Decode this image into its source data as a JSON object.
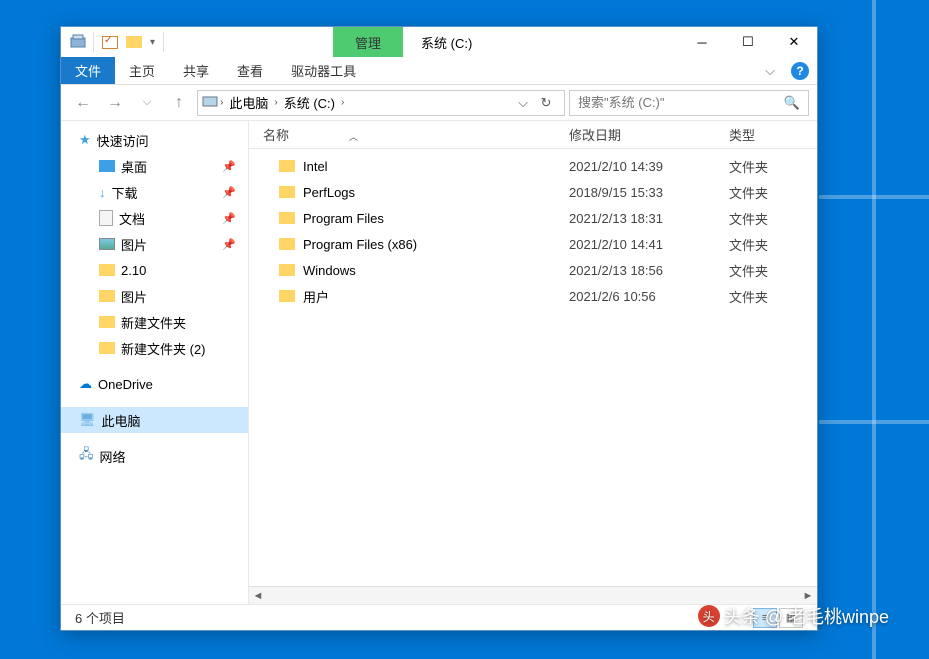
{
  "window": {
    "context_tab": "管理",
    "title": "系统 (C:)",
    "ribbon": {
      "file": "文件",
      "home": "主页",
      "share": "共享",
      "view": "查看",
      "drive_tools": "驱动器工具"
    }
  },
  "address": {
    "root": "此电脑",
    "location": "系统 (C:)"
  },
  "search": {
    "placeholder": "搜索\"系统 (C:)\""
  },
  "nav": {
    "quick_access": "快速访问",
    "desktop": "桌面",
    "downloads": "下载",
    "documents": "文档",
    "pictures": "图片",
    "folder_210": "2.10",
    "pictures2": "图片",
    "new_folder": "新建文件夹",
    "new_folder2": "新建文件夹 (2)",
    "onedrive": "OneDrive",
    "this_pc": "此电脑",
    "network": "网络"
  },
  "columns": {
    "name": "名称",
    "date_modified": "修改日期",
    "type": "类型"
  },
  "files": [
    {
      "name": "Intel",
      "date": "2021/2/10 14:39",
      "type": "文件夹"
    },
    {
      "name": "PerfLogs",
      "date": "2018/9/15 15:33",
      "type": "文件夹"
    },
    {
      "name": "Program Files",
      "date": "2021/2/13 18:31",
      "type": "文件夹"
    },
    {
      "name": "Program Files (x86)",
      "date": "2021/2/10 14:41",
      "type": "文件夹"
    },
    {
      "name": "Windows",
      "date": "2021/2/13 18:56",
      "type": "文件夹"
    },
    {
      "name": "用户",
      "date": "2021/2/6 10:56",
      "type": "文件夹"
    }
  ],
  "status": {
    "item_count": "6 个项目"
  },
  "watermark": "头条 @ 老毛桃winpe"
}
